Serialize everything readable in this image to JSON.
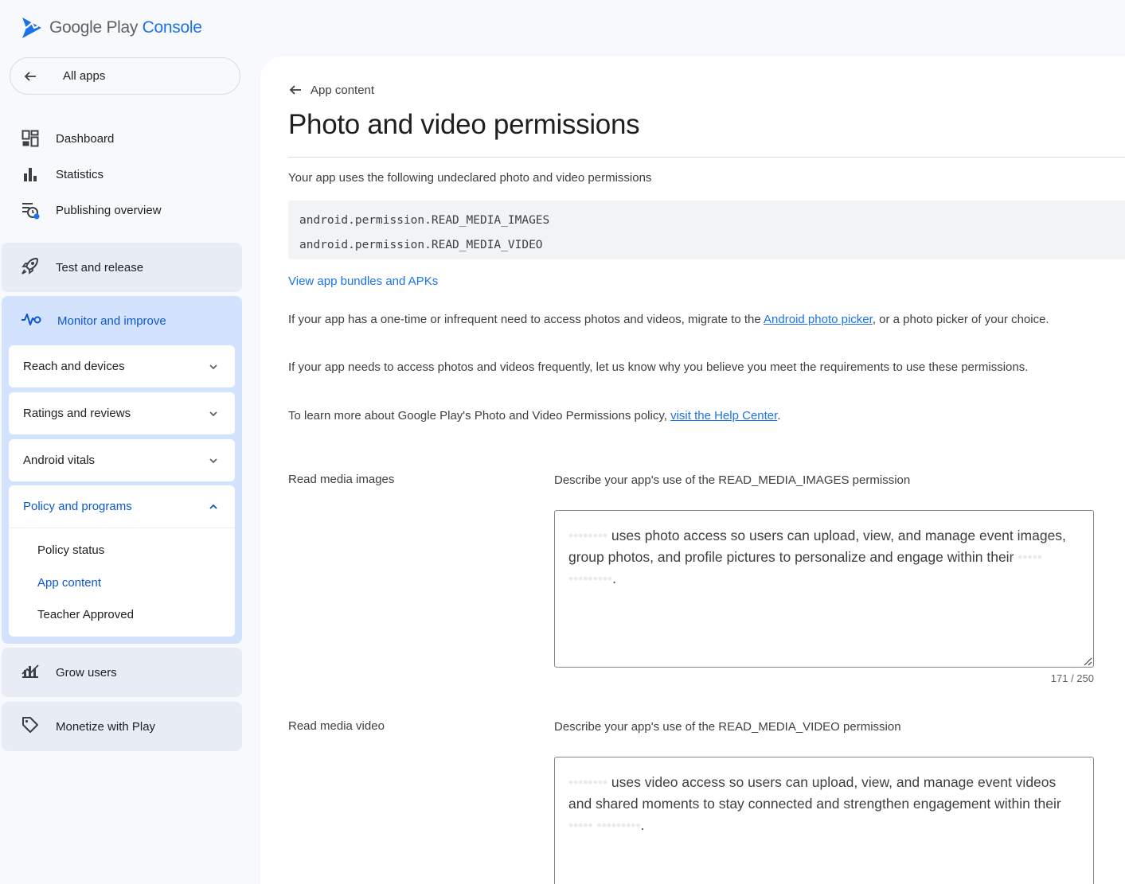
{
  "header": {
    "logo_brand": "Google Play",
    "logo_product": "Console"
  },
  "sidebar": {
    "all_apps": "All apps",
    "top_items": [
      {
        "label": "Dashboard"
      },
      {
        "label": "Statistics"
      },
      {
        "label": "Publishing overview"
      }
    ],
    "groups": {
      "test_release": "Test and release",
      "monitor_improve": "Monitor and improve",
      "grow_users": "Grow users",
      "monetize": "Monetize with Play"
    },
    "monitor_children": {
      "reach": "Reach and devices",
      "ratings": "Ratings and reviews",
      "vitals": "Android vitals",
      "policy": "Policy and programs",
      "policy_links": [
        "Policy status",
        "App content",
        "Teacher Approved"
      ]
    }
  },
  "main": {
    "back_label": "App content",
    "title": "Photo and video permissions",
    "intro": "Your app uses the following undeclared photo and video permissions",
    "permissions": [
      "android.permission.READ_MEDIA_IMAGES",
      "android.permission.READ_MEDIA_VIDEO"
    ],
    "bundles_link": "View app bundles and APKs",
    "para1_before": "If your app has a one-time or infrequent need to access photos and videos, migrate to the ",
    "para1_link": "Android photo picker",
    "para1_after": ", or a photo picker of your choice.",
    "para2": "If your app needs to access photos and videos frequently, let us know why you believe you meet the requirements to use these permissions.",
    "para3_before": "To learn more about Google Play's Photo and Video Permissions policy, ",
    "para3_link": "visit the Help Center",
    "para3_after": ".",
    "images": {
      "label": "Read media images",
      "description": "Describe your app's use of the READ_MEDIA_IMAGES permission",
      "value_redacted_start": "••••••••",
      "value_main": " uses photo access so users can upload, view, and manage event images, group photos, and profile pictures to personalize and engage within their",
      "value_redacted_end": " ••••• •••••••••",
      "value_end": ".",
      "counter": "171 / 250"
    },
    "video": {
      "label": "Read media video",
      "description": "Describe your app's use of the READ_MEDIA_VIDEO permission",
      "value_redacted_start": "••••••••",
      "value_main": " uses video access so users can upload, view, and manage event videos and shared moments to stay connected and strengthen engagement within their",
      "value_redacted_end": " ••••• •••••••••",
      "value_end": "."
    }
  },
  "colors": {
    "accent": "#1a73e8",
    "active_group_bg": "#d3e3fd",
    "group_bg": "#e8ecf4"
  }
}
